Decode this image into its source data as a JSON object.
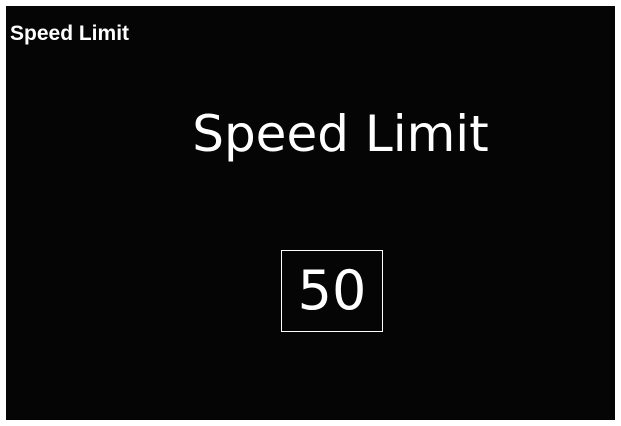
{
  "window": {
    "title": "Speed Limit"
  },
  "main": {
    "heading": "Speed Limit",
    "value": "50"
  },
  "colors": {
    "background": "#050505",
    "text": "#ffffff",
    "border": "#ffffff"
  }
}
